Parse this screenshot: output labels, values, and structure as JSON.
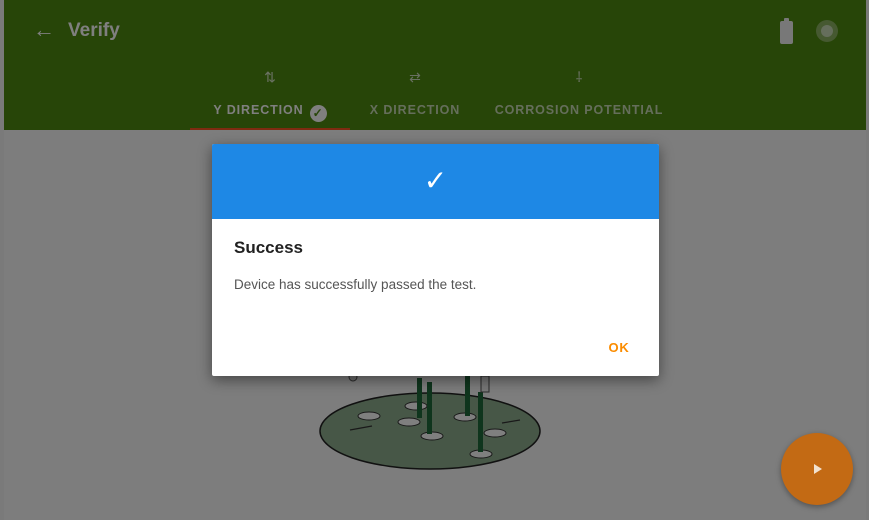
{
  "app": {
    "title": "Verify"
  },
  "header": {
    "back_icon": "arrow-left-icon",
    "battery_icon": "battery-icon",
    "record_icon": "record-icon"
  },
  "tabs": [
    {
      "label": "Y DIRECTION",
      "icon": "vertical-arrows-icon",
      "glyph": "⇅",
      "active": true,
      "completed": true
    },
    {
      "label": "X DIRECTION",
      "icon": "horizontal-arrows-icon",
      "glyph": "⇄",
      "active": false,
      "completed": false
    },
    {
      "label": "CORROSION POTENTIAL",
      "icon": "probe-icon",
      "glyph": "⸸",
      "active": false,
      "completed": false
    }
  ],
  "dialog": {
    "icon": "check-icon",
    "title": "Success",
    "message": "Device has successfully passed the test.",
    "ok_label": "OK"
  },
  "fab": {
    "icon": "play-icon"
  },
  "colors": {
    "appbar": "#4f8a10",
    "tab_indicator": "#ff5722",
    "dialog_header": "#1e88e5",
    "ok_button": "#fb8c00",
    "fab": "#c36a14"
  }
}
